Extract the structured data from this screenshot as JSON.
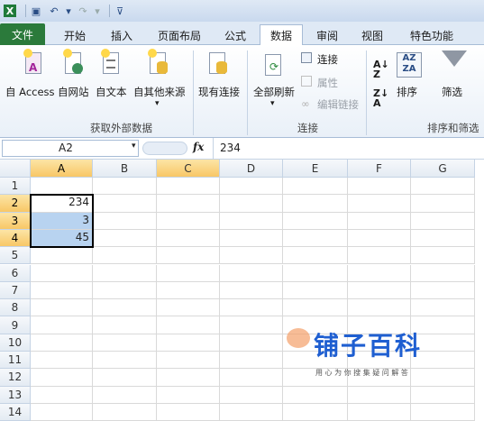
{
  "qat": {
    "icons": [
      "excel-icon",
      "save-icon",
      "undo-icon",
      "redo-icon",
      "customize-icon"
    ]
  },
  "tabs": [
    {
      "label": "文件"
    },
    {
      "label": "开始"
    },
    {
      "label": "插入"
    },
    {
      "label": "页面布局"
    },
    {
      "label": "公式"
    },
    {
      "label": "数据"
    },
    {
      "label": "审阅"
    },
    {
      "label": "视图"
    },
    {
      "label": "特色功能"
    }
  ],
  "ribbon": {
    "get_external": {
      "items": [
        "自 Access",
        "自网站",
        "自文本",
        "自其他来源",
        "现有连接"
      ],
      "group_label": "获取外部数据"
    },
    "connections": {
      "refresh_all": "全部刷新",
      "connections": "连接",
      "properties": "属性",
      "edit_links": "编辑链接",
      "group_label": "连接"
    },
    "sort_filter": {
      "sort": "排序",
      "filter": "筛选",
      "group_label": "排序和筛选"
    }
  },
  "formula_bar": {
    "name_box": "A2",
    "fx": "fx",
    "value": "234"
  },
  "columns": [
    "A",
    "B",
    "C",
    "D",
    "E",
    "F",
    "G"
  ],
  "rows": [
    "1",
    "2",
    "3",
    "4",
    "5",
    "6",
    "7",
    "8",
    "9",
    "10",
    "11",
    "12",
    "13",
    "14"
  ],
  "cells": {
    "A2": "234",
    "A3": "3",
    "A4": "45"
  },
  "watermark": {
    "title": "铺子百科",
    "subtitle": "用 心 为 你 搜 集 疑 问 解 答"
  }
}
